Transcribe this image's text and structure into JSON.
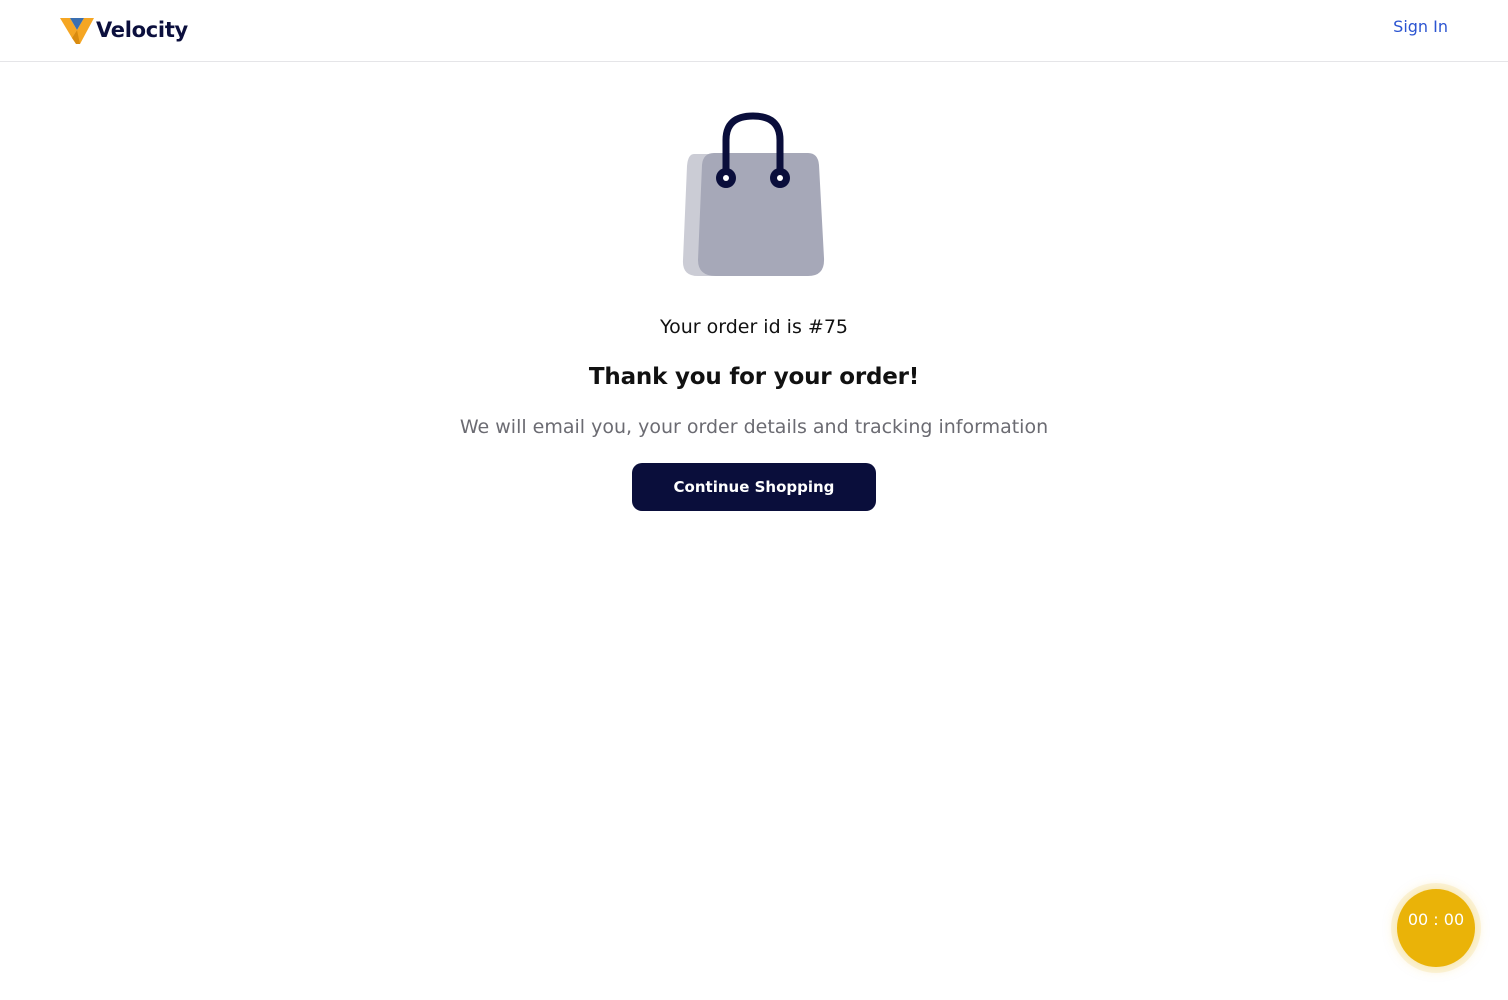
{
  "header": {
    "brand": "Velocity",
    "sign_in_label": "Sign In"
  },
  "confirmation": {
    "order_id_text": "Your order id is #75",
    "title": "Thank you for your order!",
    "message": "We will email you, your order details and tracking information",
    "continue_label": "Continue Shopping"
  },
  "timer": {
    "value": "00 : 00"
  },
  "icons": {
    "logo": "velocity-logo-icon",
    "bag": "shopping-bag-icon"
  },
  "colors": {
    "brand_navy": "#0a0e3b",
    "link_blue": "#2b54d1",
    "timer_yellow": "#eab308",
    "bag_gray": "#a6a8b8"
  }
}
